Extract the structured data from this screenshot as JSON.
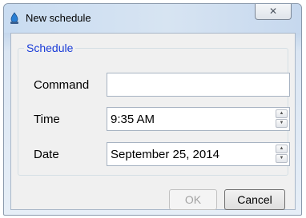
{
  "window": {
    "title": "New schedule",
    "close_glyph": "✕",
    "icon": "app-icon"
  },
  "group": {
    "legend": "Schedule"
  },
  "command": {
    "label": "Command",
    "value": ""
  },
  "time": {
    "label": "Time",
    "value": "9:35 AM"
  },
  "date": {
    "label": "Date",
    "value": "September 25, 2014"
  },
  "spinner": {
    "up_glyph": "▲",
    "down_glyph": "▼"
  },
  "buttons": {
    "ok_label": "OK",
    "ok_enabled": false,
    "cancel_label": "Cancel"
  },
  "colors": {
    "legend": "#1a3cd8",
    "disabled_text": "#a3a3a3"
  }
}
